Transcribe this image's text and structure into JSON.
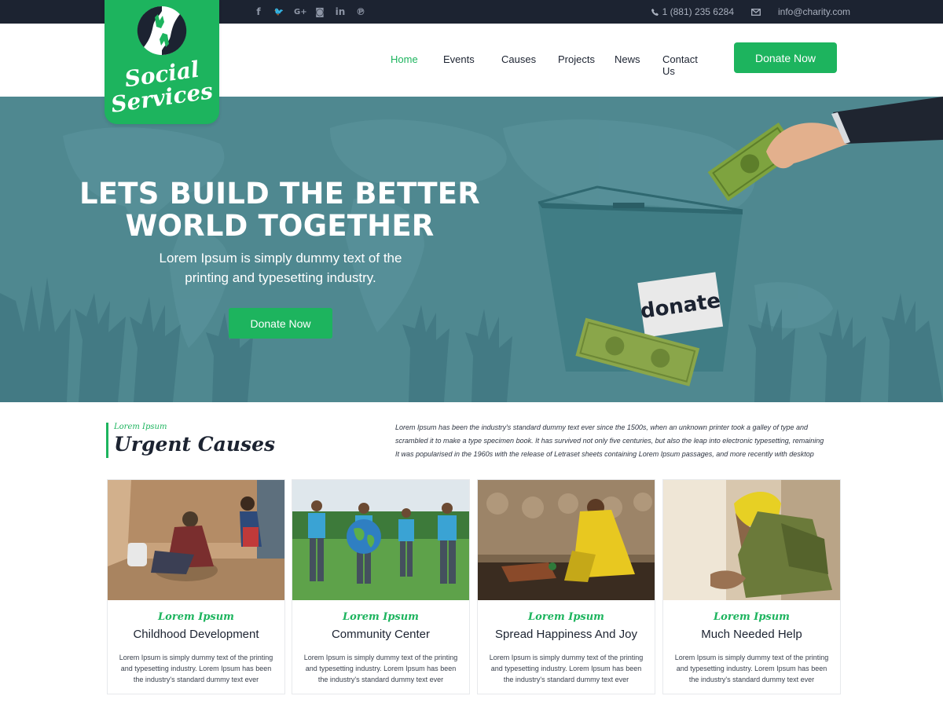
{
  "topbar": {
    "social": [
      {
        "icon": "facebook-icon",
        "glyph": "f"
      },
      {
        "icon": "twitter-icon",
        "glyph": "🐦"
      },
      {
        "icon": "google-plus-icon",
        "glyph": "G+"
      },
      {
        "icon": "instagram-icon",
        "glyph": "◙"
      },
      {
        "icon": "linkedin-icon",
        "glyph": "in"
      },
      {
        "icon": "pinterest-icon",
        "glyph": "℗"
      }
    ],
    "phone": "1 (881)  235 6284",
    "email": "info@charity.com"
  },
  "logo": {
    "line1": "Social",
    "line2": "Services"
  },
  "nav": {
    "items": [
      {
        "label": "Home",
        "active": true
      },
      {
        "label": "Events"
      },
      {
        "label": "Causes"
      },
      {
        "label": "Projects"
      },
      {
        "label": "News"
      },
      {
        "label": "Contact Us"
      }
    ],
    "donate_label": "Donate Now"
  },
  "hero": {
    "title_line1": "LETS BUILD THE BETTER",
    "title_line2": "WORLD TOGETHER",
    "subtitle_line1": "Lorem Ipsum is simply dummy text of the",
    "subtitle_line2": "printing and typesetting industry.",
    "button_label": "Donate Now",
    "box_label": "donate"
  },
  "section": {
    "kicker": "Lorem Ipsum",
    "title": "Urgent Causes",
    "description_lines": [
      "Lorem Ipsum has been the industry's standard dummy text ever since the 1500s, when an unknown printer took a galley of type and",
      "scrambled it to make a type specimen book. It has survived not only five centuries, but also the leap into electronic typesetting, remaining",
      "It was popularised in the 1960s with the release of Letraset sheets containing Lorem Ipsum passages, and more recently with desktop"
    ]
  },
  "cards": [
    {
      "kicker": "Lorem Ipsum",
      "title": "Childhood Development",
      "text_lines": [
        "Lorem Ipsum is simply dummy text of the printing",
        "and typesetting industry. Lorem Ipsum has been",
        "the industry's standard dummy text ever"
      ]
    },
    {
      "kicker": "Lorem Ipsum",
      "title": "Community Center",
      "text_lines": [
        "Lorem Ipsum is simply dummy text of the printing",
        "and typesetting industry. Lorem Ipsum has been",
        "the industry's standard dummy text ever"
      ]
    },
    {
      "kicker": "Lorem Ipsum",
      "title": "Spread Happiness And Joy",
      "text_lines": [
        "Lorem Ipsum is simply dummy text of the printing",
        "and typesetting industry. Lorem Ipsum has been",
        "the industry's standard dummy text ever"
      ]
    },
    {
      "kicker": "Lorem Ipsum",
      "title": "Much Needed Help",
      "text_lines": [
        "Lorem Ipsum is simply dummy text of the printing",
        "and typesetting industry. Lorem Ipsum has been",
        "the industry's standard dummy text ever"
      ]
    }
  ],
  "colors": {
    "accent": "#1db45e",
    "topbar": "#1c2331",
    "hero": "#4f8890"
  }
}
